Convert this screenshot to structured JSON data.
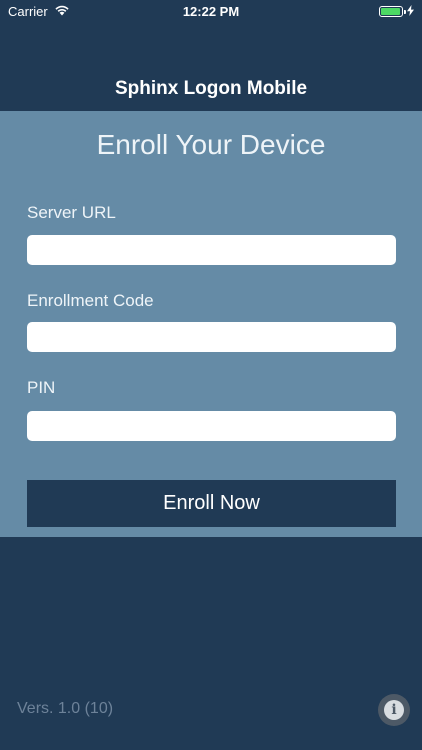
{
  "status_bar": {
    "carrier": "Carrier",
    "time": "12:22 PM",
    "wifi_icon": "wifi-icon",
    "battery_icon": "battery-icon",
    "charging_icon": "lightning-icon",
    "battery_color": "#4cd964"
  },
  "app": {
    "title": "Sphinx Logon Mobile"
  },
  "enroll": {
    "heading": "Enroll Your Device",
    "fields": [
      {
        "label": "Server URL",
        "value": "",
        "placeholder": ""
      },
      {
        "label": "Enrollment Code",
        "value": "",
        "placeholder": ""
      },
      {
        "label": "PIN",
        "value": "",
        "placeholder": ""
      }
    ],
    "button_label": "Enroll Now"
  },
  "footer": {
    "version": "Vers. 1.0 (10)",
    "info_icon": "info-icon"
  },
  "colors": {
    "background": "#203a55",
    "panel": "#658ba6",
    "button": "#203a55",
    "version_text": "#6d8299"
  }
}
